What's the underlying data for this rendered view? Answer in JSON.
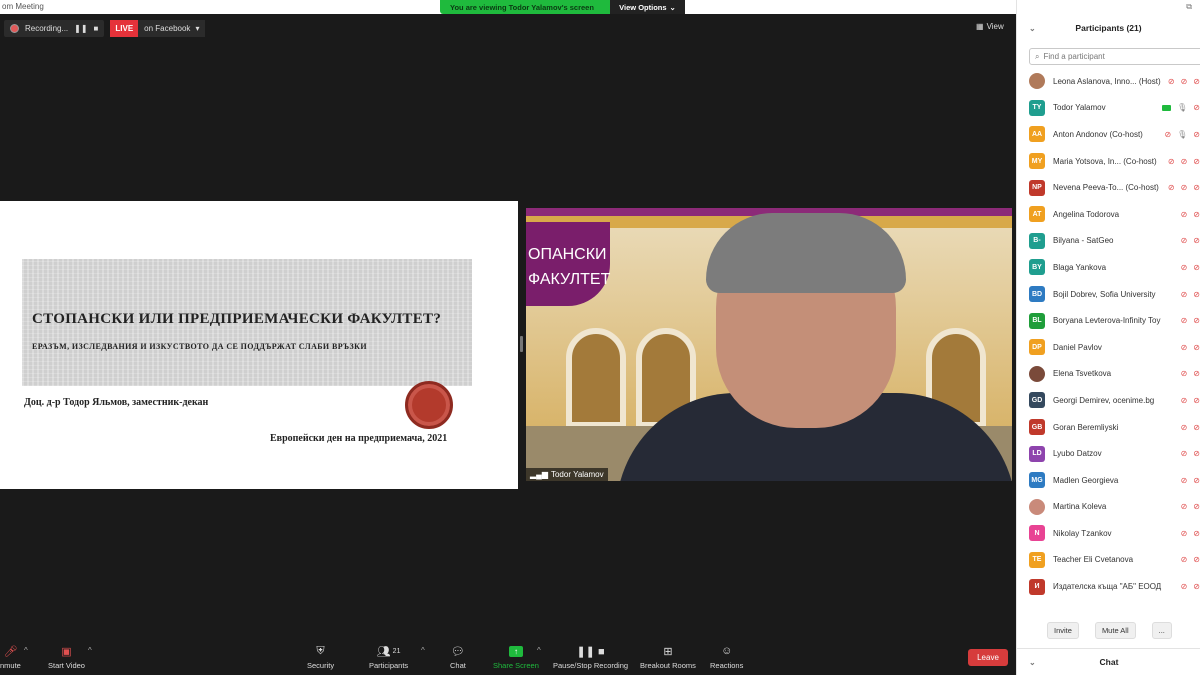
{
  "window": {
    "title": "om Meeting"
  },
  "banner": {
    "viewing": "You are viewing Todor Yalamov's screen",
    "view_options": "View Options"
  },
  "recording": {
    "label": "Recording...",
    "live": "LIVE",
    "destination": "on Facebook"
  },
  "view_button": {
    "label": "View"
  },
  "slide": {
    "title": "СТОПАНСКИ ИЛИ ПРЕДПРИЕМАЧЕСКИ ФАКУЛТЕТ?",
    "subtitle": "ЕРАЗЪМ, ИЗСЛЕДВАНИЯ И ИЗКУСТВОТО ДА СЕ ПОДДЪРЖАТ СЛАБИ ВРЪЗКИ",
    "author": "Доц. д-р Тодор Яльмов, заместник-декан",
    "event": "Европейски ден на предприемача, 2021"
  },
  "video": {
    "banner_text": "ОПАНСКИ ФАКУЛТЕТ",
    "name": "Todor Yalamov"
  },
  "toolbar": {
    "unmute": "nmute",
    "start_video": "Start Video",
    "security": "Security",
    "participants": "Participants",
    "participants_count": "21",
    "chat": "Chat",
    "share_screen": "Share Screen",
    "pause_stop_recording": "Pause/Stop Recording",
    "breakout_rooms": "Breakout Rooms",
    "reactions": "Reactions",
    "leave": "Leave"
  },
  "participants_panel": {
    "title": "Participants (21)",
    "search_placeholder": "Find a participant",
    "invite": "Invite",
    "mute_all": "Mute All",
    "more": "...",
    "chat_label": "Chat",
    "participants": [
      {
        "initials": "",
        "name": "Leona Aslanova, Inno... (Host)",
        "color": "#b07a5a",
        "photo": true,
        "mic": "muted",
        "video": "off"
      },
      {
        "initials": "TY",
        "name": "Todor Yalamov",
        "color": "#1f9e8f",
        "photo": false,
        "mic": "on",
        "video": "on"
      },
      {
        "initials": "AA",
        "name": "Anton Andonov (Co-host)",
        "color": "#f0a020",
        "photo": false,
        "mic": "on",
        "video": "off"
      },
      {
        "initials": "MY",
        "name": "Maria Yotsova, In...  (Co-host)",
        "color": "#f0a020",
        "photo": false,
        "mic": "muted",
        "video": "off"
      },
      {
        "initials": "NP",
        "name": "Nevena Peeva-To...  (Co-host)",
        "color": "#c0392b",
        "photo": false,
        "mic": "muted",
        "video": "off"
      },
      {
        "initials": "AT",
        "name": "Angelina Todorova",
        "color": "#f0a020",
        "photo": false,
        "mic": "muted",
        "video": "off"
      },
      {
        "initials": "B-",
        "name": "Bilyana - SatGeo",
        "color": "#1f9e8f",
        "photo": false,
        "mic": "muted",
        "video": "off"
      },
      {
        "initials": "BY",
        "name": "Blaga Yankova",
        "color": "#1f9e8f",
        "photo": false,
        "mic": "muted",
        "video": "off"
      },
      {
        "initials": "BD",
        "name": "Bojil Dobrev, Sofia University",
        "color": "#2e7bc2",
        "photo": false,
        "mic": "muted",
        "video": "off"
      },
      {
        "initials": "BL",
        "name": "Boryana Levterova-Infinity Toy B...",
        "color": "#1f9e3a",
        "photo": false,
        "mic": "muted",
        "video": "off"
      },
      {
        "initials": "DP",
        "name": "Daniel Pavlov",
        "color": "#f0a020",
        "photo": false,
        "mic": "muted",
        "video": "off"
      },
      {
        "initials": "",
        "name": "Elena Tsvetkova",
        "color": "#7a4a3a",
        "photo": true,
        "mic": "muted",
        "video": "off"
      },
      {
        "initials": "GD",
        "name": "Georgi Demirev, ocenime.bg",
        "color": "#34495e",
        "photo": false,
        "mic": "muted",
        "video": "off"
      },
      {
        "initials": "GB",
        "name": "Goran Beremliyski",
        "color": "#c0392b",
        "photo": false,
        "mic": "muted",
        "video": "off"
      },
      {
        "initials": "LD",
        "name": "Lyubo Datzov",
        "color": "#8e44ad",
        "photo": false,
        "mic": "muted",
        "video": "off"
      },
      {
        "initials": "MG",
        "name": "Madlen Georgieva",
        "color": "#2e7bc2",
        "photo": false,
        "mic": "muted",
        "video": "off"
      },
      {
        "initials": "",
        "name": "Martina Koleva",
        "color": "#c98a7a",
        "photo": true,
        "mic": "muted",
        "video": "off"
      },
      {
        "initials": "N",
        "name": "Nikolay Tzankov",
        "color": "#e84393",
        "photo": false,
        "mic": "muted",
        "video": "off"
      },
      {
        "initials": "TE",
        "name": "Teacher Eli Cvetanova",
        "color": "#f0a020",
        "photo": false,
        "mic": "muted",
        "video": "off"
      },
      {
        "initials": "И",
        "name": "Издателска къща \"АБ\" ЕООД",
        "color": "#c0392b",
        "photo": false,
        "mic": "muted",
        "video": "off"
      }
    ]
  }
}
